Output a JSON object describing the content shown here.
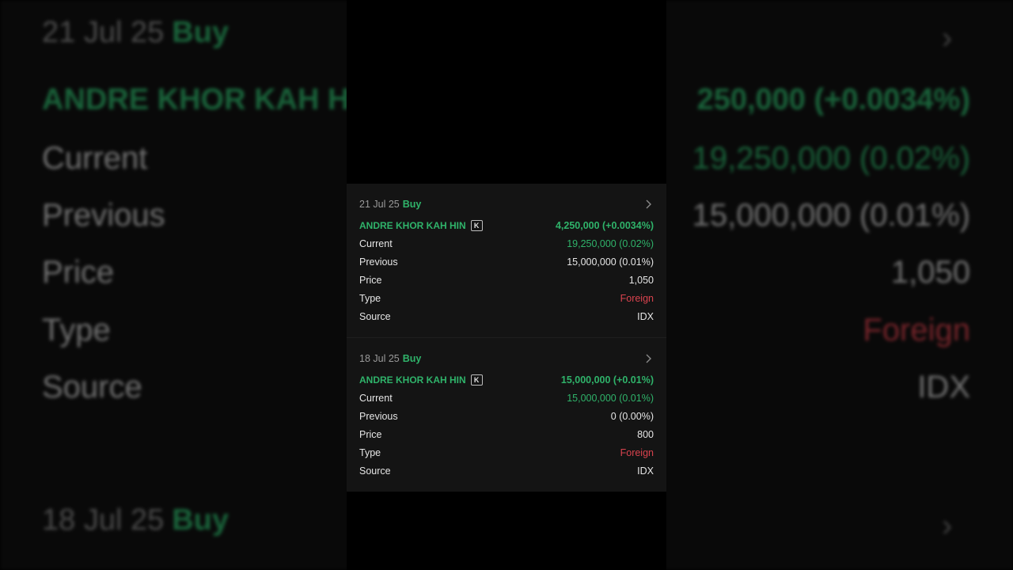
{
  "background": {
    "date": "21 Jul 25",
    "action": "Buy",
    "name": "ANDRE KHOR KAH HI",
    "change": "250,000 (+0.0034%)",
    "rows": [
      {
        "label": "Current",
        "value": "19,250,000 (0.02%)"
      },
      {
        "label": "Previous",
        "value": "15,000,000 (0.01%)"
      },
      {
        "label": "Price",
        "value": "1,050"
      },
      {
        "label": "Type",
        "value": "Foreign"
      },
      {
        "label": "Source",
        "value": "IDX"
      }
    ],
    "date2": "18 Jul 25",
    "action2": "Buy"
  },
  "transactions": [
    {
      "date": "21 Jul 25",
      "action": "Buy",
      "holder": "ANDRE KHOR KAH HIN",
      "badge": "K",
      "change": "4,250,000 (+0.0034%)",
      "current_label": "Current",
      "current": "19,250,000 (0.02%)",
      "previous_label": "Previous",
      "previous": "15,000,000 (0.01%)",
      "price_label": "Price",
      "price": "1,050",
      "type_label": "Type",
      "type": "Foreign",
      "source_label": "Source",
      "source": "IDX"
    },
    {
      "date": "18 Jul 25",
      "action": "Buy",
      "holder": "ANDRE KHOR KAH HIN",
      "badge": "K",
      "change": "15,000,000 (+0.01%)",
      "current_label": "Current",
      "current": "15,000,000 (0.01%)",
      "previous_label": "Previous",
      "previous": "0 (0.00%)",
      "price_label": "Price",
      "price": "800",
      "type_label": "Type",
      "type": "Foreign",
      "source_label": "Source",
      "source": "IDX"
    }
  ],
  "colors": {
    "buy": "#2fb36a",
    "foreign": "#d9434e",
    "panel": "#141414"
  }
}
